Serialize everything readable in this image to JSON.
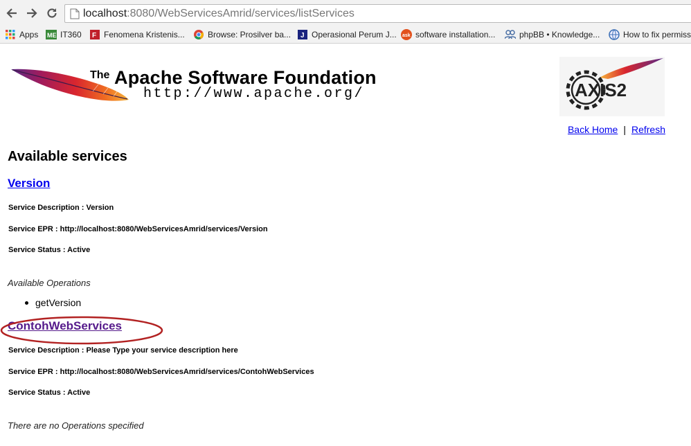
{
  "browser": {
    "url_host": "localhost",
    "url_path": ":8080/WebServicesAmrid/services/listServices",
    "bookmarks": [
      {
        "label": "Apps",
        "icon": "apps-grid-icon"
      },
      {
        "label": "IT360",
        "icon": "me-icon"
      },
      {
        "label": "Fenomena Kristenis...",
        "icon": "bookmark-f-icon"
      },
      {
        "label": "Browse: Prosilver ba...",
        "icon": "chrome-icon"
      },
      {
        "label": "Operasional Perum J...",
        "icon": "j-icon"
      },
      {
        "label": "software installation...",
        "icon": "ask-icon"
      },
      {
        "label": "phpBB • Knowledge...",
        "icon": "people-icon"
      },
      {
        "label": "How to fix permiss",
        "icon": "globe-icon"
      }
    ]
  },
  "header": {
    "asf_the": "The",
    "asf_title": "Apache Software Foundation",
    "asf_url": "http://www.apache.org/",
    "axis_text": "AXIS2"
  },
  "links": {
    "back_home": "Back Home",
    "separator": "|",
    "refresh": "Refresh"
  },
  "page_title": "Available services",
  "services": [
    {
      "name": "Version",
      "description": "Service Description : Version",
      "epr": "Service EPR : http://localhost:8080/WebServicesAmrid/services/Version",
      "status": "Service Status : Active",
      "ops_label": "Available Operations",
      "operations": [
        "getVersion"
      ]
    },
    {
      "name": "ContohWebServices",
      "description": "Service Description : Please Type your service description here",
      "epr": "Service EPR : http://localhost:8080/WebServicesAmrid/services/ContohWebServices",
      "status": "Service Status : Active",
      "ops_label": "There are no Operations specified"
    }
  ],
  "colors": {
    "link": "#0000ee",
    "visited_link": "#551a8b",
    "annotation": "#b22222"
  }
}
